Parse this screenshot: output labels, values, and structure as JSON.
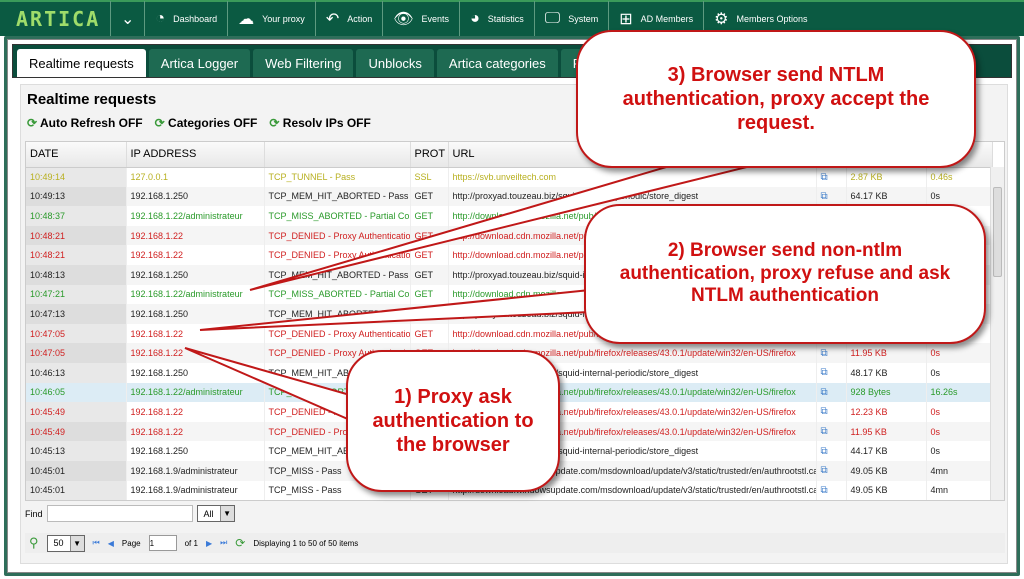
{
  "topbar": {
    "logo": "ARTICA",
    "nav": [
      {
        "label": "Dashboard",
        "icon": "dashboard-icon"
      },
      {
        "label": "Your proxy",
        "icon": "proxy-cloud-icon"
      },
      {
        "label": "Action",
        "icon": "back-arrow-icon"
      },
      {
        "label": "Events",
        "icon": "eye-icon"
      },
      {
        "label": "Statistics",
        "icon": "pie-chart-icon"
      },
      {
        "label": "System",
        "icon": "monitor-search-icon"
      },
      {
        "label": "AD Members",
        "icon": "windows-icon"
      },
      {
        "label": "Members Options",
        "icon": "members-gear-icon"
      }
    ]
  },
  "tabs": [
    "Realtime requests",
    "Artica Logger",
    "Web Filtering",
    "Unblocks",
    "Artica categories",
    "Proxy wat"
  ],
  "panel": {
    "title": "Realtime requests",
    "toolbar": [
      "Auto Refresh OFF",
      "Categories OFF",
      "Resolv IPs OFF"
    ]
  },
  "columns": [
    "DATE",
    "IP ADDRESS",
    "",
    "PROT",
    "URL",
    "",
    "",
    "N"
  ],
  "rows": [
    [
      "10:49:14",
      "127.0.0.1",
      "TCP_TUNNEL - Pass",
      "SSL",
      "https://svb.unveiltech.com",
      "2.87 KB",
      "0.46s",
      "yellow"
    ],
    [
      "10:49:13",
      "192.168.1.250",
      "TCP_MEM_HIT_ABORTED - Pass",
      "GET",
      "http://proxyad.touzeau.biz/squid-internal-periodic/store_digest",
      "64.17 KB",
      "0s",
      "black"
    ],
    [
      "10:48:37",
      "192.168.1.22/administrateur",
      "TCP_MISS_ABORTED - Partial Cont",
      "GET",
      "http://download.cdn.mozilla.net/pub/firefox/releases/43.0.1/update/win32/en-US/firefox",
      "",
      "",
      "green"
    ],
    [
      "10:48:21",
      "192.168.1.22",
      "TCP_DENIED - Proxy Authentication",
      "GET",
      "http://download.cdn.mozilla.net/pub/firefox/releases/43.0.1/update/win32/en-US/firefox",
      "",
      "",
      "red"
    ],
    [
      "10:48:21",
      "192.168.1.22",
      "TCP_DENIED - Proxy Authentication",
      "GET",
      "http://download.cdn.mozilla.net/pub/firefox/releases/43.0.1/update/win32/en-US/firefox",
      "",
      "",
      "red"
    ],
    [
      "10:48:13",
      "192.168.1.250",
      "TCP_MEM_HIT_ABORTED - Pass",
      "GET",
      "http://proxyad.touzeau.biz/squid-internal-periodic/store_digest",
      "",
      "",
      "black"
    ],
    [
      "10:47:21",
      "192.168.1.22/administrateur",
      "TCP_MISS_ABORTED - Partial Cont",
      "GET",
      "http://download.cdn.mozilla.net/pub/firefox/releases/43.0.1/update/win32/en-US/firefox",
      "",
      "",
      "green"
    ],
    [
      "10:47:13",
      "192.168.1.250",
      "TCP_MEM_HIT_ABORTED - Pass",
      "GET",
      "http://proxyad.touzeau.biz/squid-internal-periodic/store_digest",
      "",
      "",
      "black"
    ],
    [
      "10:47:05",
      "192.168.1.22",
      "TCP_DENIED - Proxy Authentication",
      "GET",
      "http://download.cdn.mozilla.net/pub/firefox/releases/43.0.1/update/win32/en-US/firefox",
      "",
      "",
      "red"
    ],
    [
      "10:47:05",
      "192.168.1.22",
      "TCP_DENIED - Proxy Authentication",
      "GET",
      "http://download.cdn.mozilla.net/pub/firefox/releases/43.0.1/update/win32/en-US/firefox",
      "11.95 KB",
      "0s",
      "red"
    ],
    [
      "10:46:13",
      "192.168.1.250",
      "TCP_MEM_HIT_ABORTED - Pass",
      "GET",
      "http://proxyad.touzeau.biz/squid-internal-periodic/store_digest",
      "48.17 KB",
      "0s",
      "black"
    ],
    [
      "10:46:05",
      "192.168.1.22/administrateur",
      "TCP_MISS_ABORTED - Partial Cont",
      "GET",
      "http://download.cdn.mozilla.net/pub/firefox/releases/43.0.1/update/win32/en-US/firefox",
      "928 Bytes",
      "16.26s",
      "green"
    ],
    [
      "10:45:49",
      "192.168.1.22",
      "TCP_DENIED - Proxy Authentication",
      "GET",
      "http://download.cdn.mozilla.net/pub/firefox/releases/43.0.1/update/win32/en-US/firefox",
      "12.23 KB",
      "0s",
      "red"
    ],
    [
      "10:45:49",
      "192.168.1.22",
      "TCP_DENIED - Proxy Authentication",
      "GET",
      "http://download.cdn.mozilla.net/pub/firefox/releases/43.0.1/update/win32/en-US/firefox",
      "11.95 KB",
      "0s",
      "red"
    ],
    [
      "10:45:13",
      "192.168.1.250",
      "TCP_MEM_HIT_ABORTED - Pass",
      "GET",
      "http://proxyad.touzeau.biz/squid-internal-periodic/store_digest",
      "44.17 KB",
      "0s",
      "black"
    ],
    [
      "10:45:01",
      "192.168.1.9/administrateur",
      "TCP_MISS - Pass",
      "GET",
      "http://download.windowsupdate.com/msdownload/update/v3/static/trustedr/en/authrootstl.cab",
      "49.05 KB",
      "4mn",
      "black"
    ],
    [
      "10:45:01",
      "192.168.1.9/administrateur",
      "TCP_MISS - Pass",
      "GET",
      "http://download.windowsupdate.com/msdownload/update/v3/static/trustedr/en/authrootstl.cab",
      "49.05 KB",
      "4mn",
      "black"
    ]
  ],
  "find": {
    "label": "Find",
    "value": "",
    "filter": "All"
  },
  "pager": {
    "per_page": "50",
    "page_label": "Page",
    "page": "1",
    "of": "of 1",
    "status": "Displaying 1 to 50 of 50 items"
  },
  "callouts": [
    "3) Browser send NTLM authentication, proxy accept the request.",
    "2) Browser send non-ntlm authentication, proxy refuse and ask NTLM authentication",
    "1) Proxy ask authentication to the browser"
  ],
  "colors": {
    "topbar": "#0b5a42",
    "callout": "#d01010",
    "yellow": "#b8b020",
    "green": "#2a9a2a",
    "red": "#d02020"
  }
}
